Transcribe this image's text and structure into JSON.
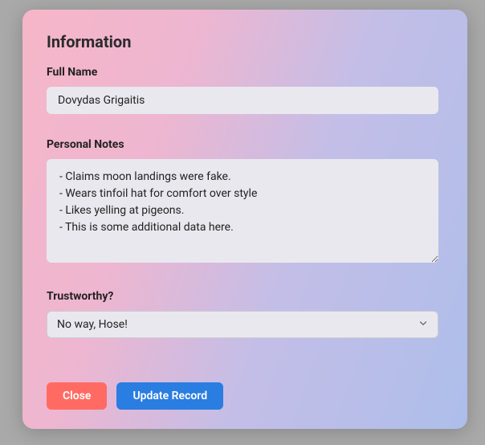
{
  "modal": {
    "title": "Information",
    "fullName": {
      "label": "Full Name",
      "value": "Dovydas Grigaitis"
    },
    "notes": {
      "label": "Personal Notes",
      "value": "- Claims moon landings were fake.\n- Wears tinfoil hat for comfort over style\n- Likes yelling at pigeons.\n- This is some additional data here."
    },
    "trustworthy": {
      "label": "Trustworthy?",
      "value": "No way, Hose!"
    },
    "buttons": {
      "close": "Close",
      "update": "Update Record"
    }
  }
}
